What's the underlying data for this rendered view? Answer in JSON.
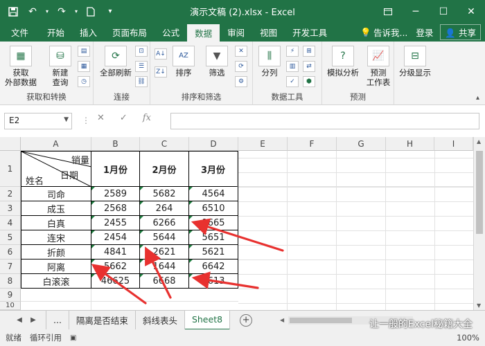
{
  "window": {
    "title": "演示文稿 (2).xlsx - Excel",
    "controls": [
      "─",
      "☐",
      "✕"
    ]
  },
  "tabs": [
    {
      "label": "文件"
    },
    {
      "label": "开始"
    },
    {
      "label": "插入"
    },
    {
      "label": "页面布局"
    },
    {
      "label": "公式"
    },
    {
      "label": "数据"
    },
    {
      "label": "审阅"
    },
    {
      "label": "视图"
    },
    {
      "label": "开发工具"
    }
  ],
  "tabs_right": {
    "tell": "告诉我...",
    "login": "登录",
    "share": "共享"
  },
  "ribbon": {
    "get_data": {
      "l1": "获取",
      "l2": "外部数据"
    },
    "new_query": {
      "l1": "新建",
      "l2": "查询"
    },
    "group1_label": "获取和转换",
    "refresh_all": "全部刷新",
    "group2_label": "连接",
    "sort": "排序",
    "filter": "筛选",
    "group3_label": "排序和筛选",
    "split": "分列",
    "group4_label": "数据工具",
    "whatif": "模拟分析",
    "forecast": {
      "l1": "预测",
      "l2": "工作表"
    },
    "group5_label": "预测",
    "outline": "分级显示"
  },
  "formula_bar": {
    "namebox": "E2",
    "value": ""
  },
  "columns": [
    "A",
    "B",
    "C",
    "D",
    "E",
    "F",
    "G",
    "H",
    "I"
  ],
  "rows": [
    "1",
    "2",
    "3",
    "4",
    "5",
    "6",
    "7",
    "8",
    "9",
    "10"
  ],
  "header": {
    "diag_top": "销量",
    "diag_mid": "日期",
    "diag_bottom": "姓名",
    "b": "1月份",
    "c": "2月份",
    "d": "3月份"
  },
  "table": [
    {
      "name": "司命",
      "b": "2589",
      "c": "5682",
      "d": "4564"
    },
    {
      "name": "成玉",
      "b": "2568",
      "c": "264",
      "d": "6510"
    },
    {
      "name": "白真",
      "b": "2455",
      "c": "6266",
      "d": "1665"
    },
    {
      "name": "连宋",
      "b": "2454",
      "c": "5644",
      "d": "5651"
    },
    {
      "name": "折颜",
      "b": "4841",
      "c": "2621",
      "d": "5621"
    },
    {
      "name": "阿离",
      "b": "5662",
      "c": "1644",
      "d": "6642"
    },
    {
      "name": "白滚滚",
      "b": "46625",
      "c": "6668",
      "d": "2613"
    }
  ],
  "sheets": {
    "more": "...",
    "s1": "隔离是否结束",
    "s2": "斜线表头",
    "s3": "Sheet8"
  },
  "status": {
    "ready": "就绪",
    "circ": "循环引用",
    "zoom": "100%"
  },
  "watermark": "让一般的Excel秘籍大全",
  "colors": {
    "brand": "#217346",
    "arrow": "#e8312f"
  }
}
